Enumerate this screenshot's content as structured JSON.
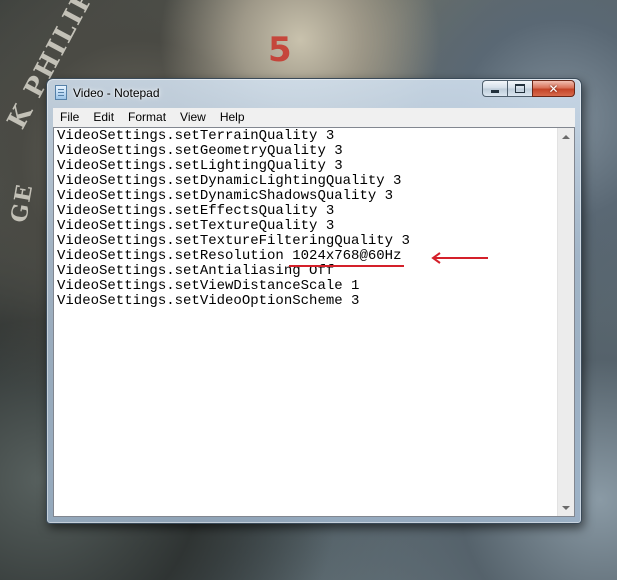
{
  "window": {
    "title": "Video - Notepad",
    "caption": {
      "close_glyph": "✕"
    }
  },
  "menu": {
    "items": [
      "File",
      "Edit",
      "Format",
      "View",
      "Help"
    ]
  },
  "document": {
    "lines": [
      "VideoSettings.setTerrainQuality 3",
      "VideoSettings.setGeometryQuality 3",
      "VideoSettings.setLightingQuality 3",
      "VideoSettings.setDynamicLightingQuality 3",
      "VideoSettings.setDynamicShadowsQuality 3",
      "VideoSettings.setEffectsQuality 3",
      "VideoSettings.setTextureQuality 3",
      "VideoSettings.setTextureFilteringQuality 3",
      "VideoSettings.setResolution ",
      "VideoSettings.setAntialiasing Off",
      "VideoSettings.setViewDistanceScale 1",
      "VideoSettings.setVideoOptionScheme 3"
    ],
    "highlighted_value": "1024x768@60Hz",
    "annotation_color": "#d4202a"
  },
  "wallpaper": {
    "brand_fragment": "K PHILIPPE",
    "dial_numeral": "5",
    "fragment": "GE"
  }
}
